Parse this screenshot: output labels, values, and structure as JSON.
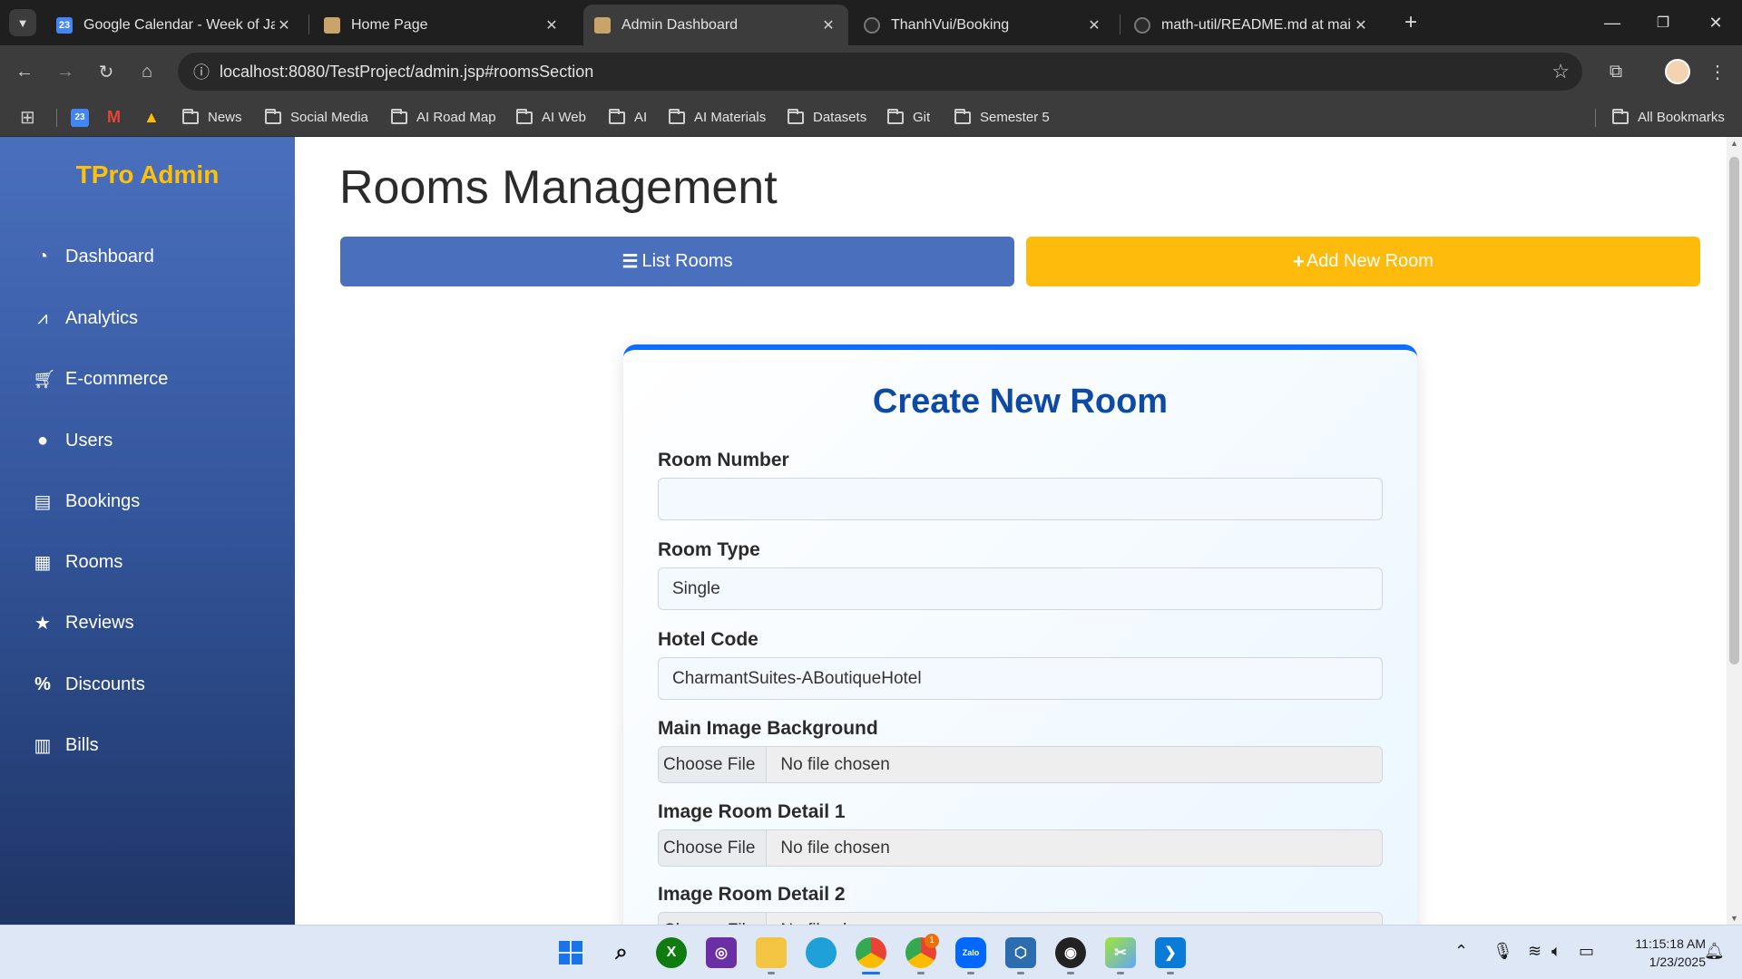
{
  "browser": {
    "tabs": [
      {
        "title": "Google Calendar - Week of Janu",
        "icon": "calendar-icon"
      },
      {
        "title": "Home Page",
        "icon": "site-icon"
      },
      {
        "title": "Admin Dashboard",
        "icon": "site-icon",
        "active": true
      },
      {
        "title": "ThanhVui/Booking",
        "icon": "github-icon"
      },
      {
        "title": "math-util/README.md at main",
        "icon": "github-icon"
      }
    ],
    "address": "localhost:8080/TestProject/admin.jsp#roomsSection",
    "bookmarks": [
      "News",
      "Social Media",
      "AI Road Map",
      "AI Web",
      "AI",
      "AI Materials",
      "Datasets",
      "Git",
      "Semester 5"
    ],
    "all_bookmarks": "All Bookmarks",
    "calendar_badge": "23"
  },
  "sidebar": {
    "brand": "TPro Admin",
    "items": [
      {
        "label": "Dashboard",
        "icon": "gauge-icon"
      },
      {
        "label": "Analytics",
        "icon": "chart-line-icon"
      },
      {
        "label": "E-commerce",
        "icon": "cart-icon"
      },
      {
        "label": "Users",
        "icon": "user-icon"
      },
      {
        "label": "Bookings",
        "icon": "book-icon"
      },
      {
        "label": "Rooms",
        "icon": "building-icon"
      },
      {
        "label": "Reviews",
        "icon": "star-icon"
      },
      {
        "label": "Discounts",
        "icon": "percent-icon"
      },
      {
        "label": "Bills",
        "icon": "invoice-icon"
      }
    ]
  },
  "main": {
    "title": "Rooms Management",
    "list_button": "List Rooms",
    "add_button": "Add New Room",
    "form": {
      "title": "Create New Room",
      "room_number_label": "Room Number",
      "room_number_value": "",
      "room_type_label": "Room Type",
      "room_type_value": "Single",
      "hotel_code_label": "Hotel Code",
      "hotel_code_value": "CharmantSuites-ABoutiqueHotel",
      "main_image_label": "Main Image Background",
      "detail1_label": "Image Room Detail 1",
      "detail2_label": "Image Room Detail 2",
      "choose_file": "Choose File",
      "no_file": "No file chosen"
    }
  },
  "taskbar": {
    "time": "11:15:18 AM",
    "date": "1/23/2025",
    "chrome_badge": "1",
    "zalo_label": "Zalo"
  },
  "colors": {
    "sidebar_top": "#4a6fbd",
    "sidebar_bottom": "#1f3566",
    "brand": "#ffc107",
    "list_button": "#4a6fbd",
    "add_button": "#ffbb0b",
    "form_title": "#0d4aa6",
    "card_accent": "#0d6efd"
  }
}
